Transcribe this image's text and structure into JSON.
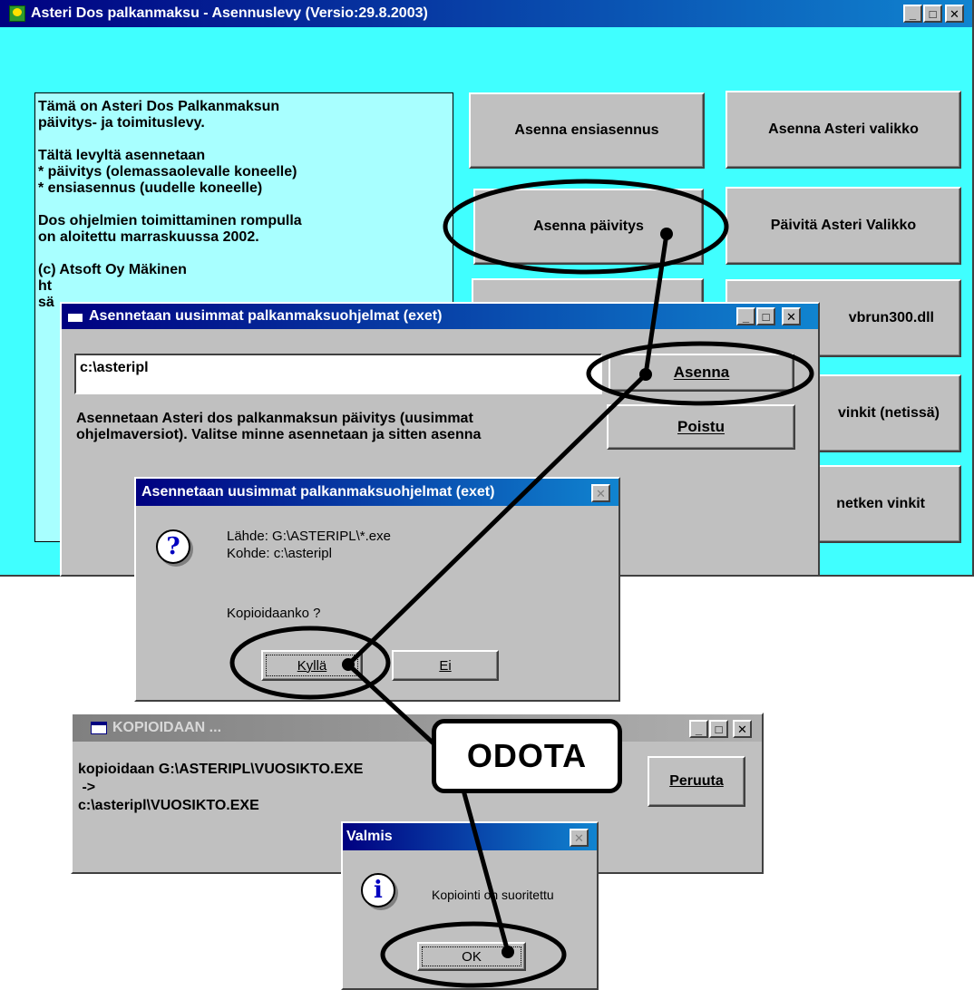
{
  "main": {
    "title": "Asteri Dos palkanmaksu - Asennuslevy (Versio:29.8.2003)",
    "info_text": "Tämä on Asteri Dos Palkanmaksun\npäivitys- ja toimituslevy.\n\nTältä levyltä asennetaan\n* päivitys (olemassaolevalle koneelle)\n* ensiasennus (uudelle koneelle)\n\nDos ohjelmien toimittaminen rompulla\non aloitettu marraskuussa 2002.\n\n(c) Atsoft Oy Mäkinen\nht\nsä",
    "buttons": {
      "ensiasennus": "Asenna ensiasennus",
      "asteri_valikko": "Asenna Asteri valikko",
      "paivitys": "Asenna päivitys",
      "paivita_valikko": "Päivitä Asteri Valikko",
      "vbrun": "vbrun300.dll",
      "vinkit_netissa": "vinkit (netissä)",
      "netken_vinkit": "netken vinkit"
    }
  },
  "install_dialog": {
    "title": "Asennetaan uusimmat palkanmaksuohjelmat (exet)",
    "path_value": "c:\\asteripl",
    "install_button": "Asenna",
    "exit_button": "Poistu",
    "description": "Asennetaan Asteri dos palkanmaksun päivitys (uusimmat\nohjelmaversiot). Valitse minne asennetaan ja sitten asenna"
  },
  "confirm_dialog": {
    "title": "Asennetaan uusimmat palkanmaksuohjelmat (exet)",
    "source": "Lähde: G:\\ASTERIPL\\*.exe",
    "target": "Kohde: c:\\asteripl",
    "question": "Kopioidaanko ?",
    "yes_button": "Kyllä",
    "no_button": "Ei",
    "icon": "question-icon"
  },
  "copy_dialog": {
    "title": "KOPIOIDAAN ...",
    "line1": "kopioidaan G:\\ASTERIPL\\VUOSIKTO.EXE",
    "line2": " ->",
    "line3": "c:\\asteripl\\VUOSIKTO.EXE",
    "cancel_button": "Peruuta"
  },
  "done_dialog": {
    "title": "Valmis",
    "message": "Kopiointi on suoritettu",
    "ok_button": "OK",
    "icon": "info-icon"
  },
  "callout": {
    "label": "ODOTA"
  },
  "colors": {
    "main_background": "#40ffff",
    "info_panel": "#a8ffff",
    "title_active": "#000080",
    "annotation": "#000000"
  }
}
